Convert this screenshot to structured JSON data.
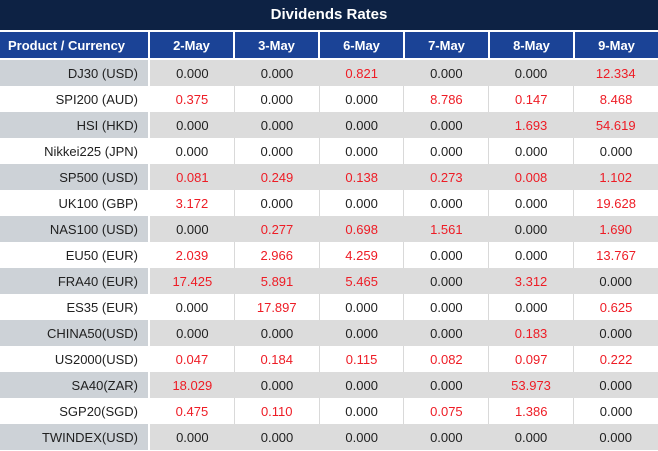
{
  "page": {
    "title": "Dividends Rates"
  },
  "colors": {
    "title_bar_bg": "#0d2244",
    "header_bg": "#1b4396",
    "row_alt_bg": "#dcdcdc",
    "product_col_alt_bg": "#cdd2d7",
    "value_red": "#ee1c25",
    "value_black": "#212121",
    "header_text": "#ffffff",
    "divider_white": "#ffffff",
    "divider_gray": "#d9d9d9"
  },
  "chart_data": {
    "type": "table",
    "title": "Dividends Rates",
    "columns": [
      "Product / Currency",
      "2-May",
      "3-May",
      "6-May",
      "7-May",
      "8-May",
      "9-May"
    ],
    "highlight_rule": "non-zero values rendered in red",
    "rows": [
      {
        "product": "DJ30 (USD)",
        "values": [
          "0.000",
          "0.000",
          "0.821",
          "0.000",
          "0.000",
          "12.334"
        ]
      },
      {
        "product": "SPI200 (AUD)",
        "values": [
          "0.375",
          "0.000",
          "0.000",
          "8.786",
          "0.147",
          "8.468"
        ]
      },
      {
        "product": "HSI (HKD)",
        "values": [
          "0.000",
          "0.000",
          "0.000",
          "0.000",
          "1.693",
          "54.619"
        ]
      },
      {
        "product": "Nikkei225 (JPN)",
        "values": [
          "0.000",
          "0.000",
          "0.000",
          "0.000",
          "0.000",
          "0.000"
        ]
      },
      {
        "product": "SP500 (USD)",
        "values": [
          "0.081",
          "0.249",
          "0.138",
          "0.273",
          "0.008",
          "1.102"
        ]
      },
      {
        "product": "UK100 (GBP)",
        "values": [
          "3.172",
          "0.000",
          "0.000",
          "0.000",
          "0.000",
          "19.628"
        ]
      },
      {
        "product": "NAS100 (USD)",
        "values": [
          "0.000",
          "0.277",
          "0.698",
          "1.561",
          "0.000",
          "1.690"
        ]
      },
      {
        "product": "EU50 (EUR)",
        "values": [
          "2.039",
          "2.966",
          "4.259",
          "0.000",
          "0.000",
          "13.767"
        ]
      },
      {
        "product": "FRA40 (EUR)",
        "values": [
          "17.425",
          "5.891",
          "5.465",
          "0.000",
          "3.312",
          "0.000"
        ]
      },
      {
        "product": "ES35 (EUR)",
        "values": [
          "0.000",
          "17.897",
          "0.000",
          "0.000",
          "0.000",
          "0.625"
        ]
      },
      {
        "product": "CHINA50(USD)",
        "values": [
          "0.000",
          "0.000",
          "0.000",
          "0.000",
          "0.183",
          "0.000"
        ]
      },
      {
        "product": "US2000(USD)",
        "values": [
          "0.047",
          "0.184",
          "0.115",
          "0.082",
          "0.097",
          "0.222"
        ]
      },
      {
        "product": "SA40(ZAR)",
        "values": [
          "18.029",
          "0.000",
          "0.000",
          "0.000",
          "53.973",
          "0.000"
        ]
      },
      {
        "product": "SGP20(SGD)",
        "values": [
          "0.475",
          "0.110",
          "0.000",
          "0.075",
          "1.386",
          "0.000"
        ]
      },
      {
        "product": "TWINDEX(USD)",
        "values": [
          "0.000",
          "0.000",
          "0.000",
          "0.000",
          "0.000",
          "0.000"
        ]
      }
    ]
  }
}
